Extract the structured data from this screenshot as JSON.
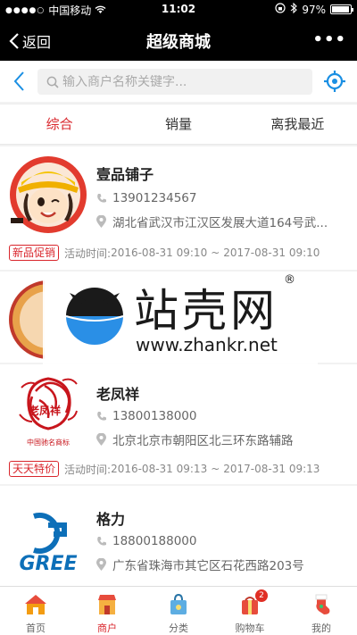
{
  "status_bar": {
    "carrier": "中国移动",
    "time": "11:02",
    "battery": "97%",
    "battery_level": 0.97
  },
  "nav": {
    "back_label": "返回",
    "title": "超级商城",
    "more_label": "•••"
  },
  "search": {
    "placeholder": "输入商户名称关键字..."
  },
  "tabs": [
    {
      "label": "综合",
      "active": true
    },
    {
      "label": "销量",
      "active": false
    },
    {
      "label": "离我最近",
      "active": false
    }
  ],
  "stores": [
    {
      "name": "壹品铺子",
      "phone": "13901234567",
      "address": "湖北省武汉市江汉区发展大道164号武...",
      "promo": {
        "badge": "新品促销",
        "label": "活动时间:",
        "start": "2016-08-31 09:10",
        "sep": "~",
        "end": "2017-08-31 09:10"
      }
    },
    {
      "name": "老凤祥",
      "logo_caption": "中国驰名商标",
      "logo_brand": "老凤祥",
      "phone": "13800138000",
      "address": "北京北京市朝阳区北三环东路辅路",
      "promo": {
        "badge": "天天特价",
        "label": "活动时间:",
        "start": "2016-08-31 09:13",
        "sep": "~",
        "end": "2017-08-31 09:13"
      }
    },
    {
      "name": "格力",
      "logo_brand": "GREE",
      "phone": "18800188000",
      "address": "广东省珠海市其它区石花西路203号"
    }
  ],
  "watermark": {
    "text": "站壳网",
    "reg": "®",
    "url": "www.zhankr.net"
  },
  "tabbar": [
    {
      "label": "首页",
      "active": false
    },
    {
      "label": "商户",
      "active": true
    },
    {
      "label": "分类",
      "active": false
    },
    {
      "label": "购物车",
      "active": false,
      "badge": "2"
    },
    {
      "label": "我的",
      "active": false
    }
  ],
  "colors": {
    "accent": "#d9262c",
    "nav_bg": "#000000",
    "link_blue": "#1a8fe3"
  }
}
